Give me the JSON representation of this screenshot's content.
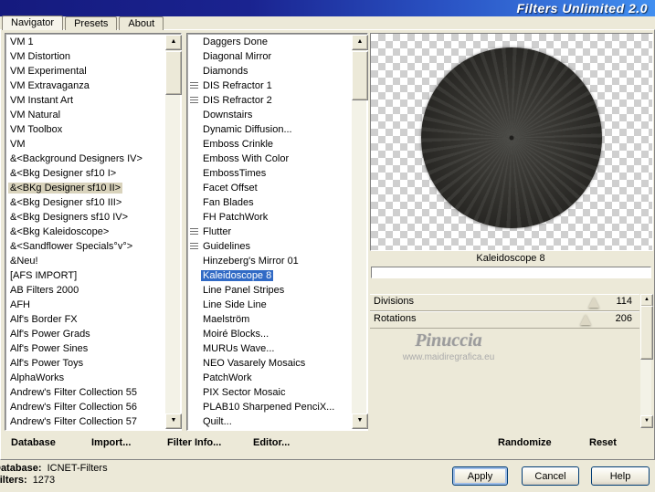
{
  "window": {
    "title": "Filters Unlimited 2.0"
  },
  "tabs": [
    {
      "label": "Navigator",
      "active": true
    },
    {
      "label": "Presets",
      "active": false
    },
    {
      "label": "About",
      "active": false
    }
  ],
  "categories": {
    "selected": "&<BKg Designer sf10 II>",
    "items": [
      {
        "label": "VM 1"
      },
      {
        "label": "VM Distortion"
      },
      {
        "label": "VM Experimental"
      },
      {
        "label": "VM Extravaganza"
      },
      {
        "label": "VM Instant Art"
      },
      {
        "label": "VM Natural"
      },
      {
        "label": "VM Toolbox"
      },
      {
        "label": "VM"
      },
      {
        "label": "&<Background Designers IV>"
      },
      {
        "label": "&<Bkg Designer sf10 I>"
      },
      {
        "label": "&<BKg Designer sf10 II>",
        "selected": true
      },
      {
        "label": "&<Bkg Designer sf10 III>"
      },
      {
        "label": "&<Bkg Designers sf10 IV>"
      },
      {
        "label": "&<Bkg Kaleidoscope>"
      },
      {
        "label": "&<Sandflower Specials°v°>"
      },
      {
        "label": "&Neu!"
      },
      {
        "label": "[AFS IMPORT]"
      },
      {
        "label": "AB Filters 2000"
      },
      {
        "label": "AFH"
      },
      {
        "label": "Alf's Border FX"
      },
      {
        "label": "Alf's Power Grads"
      },
      {
        "label": "Alf's Power Sines"
      },
      {
        "label": "Alf's Power Toys"
      },
      {
        "label": "AlphaWorks"
      },
      {
        "label": "Andrew's Filter Collection 55"
      },
      {
        "label": "Andrew's Filter Collection 56"
      },
      {
        "label": "Andrew's Filter Collection 57"
      }
    ]
  },
  "filters": {
    "selected": "Kaleidoscope 8",
    "items": [
      {
        "label": "Daggers Done"
      },
      {
        "label": "Diagonal Mirror"
      },
      {
        "label": "Diamonds"
      },
      {
        "label": "DIS Refractor 1",
        "icon": true
      },
      {
        "label": "DIS Refractor 2",
        "icon": true
      },
      {
        "label": "Downstairs"
      },
      {
        "label": "Dynamic Diffusion..."
      },
      {
        "label": "Emboss Crinkle"
      },
      {
        "label": "Emboss With Color"
      },
      {
        "label": "EmbossTimes"
      },
      {
        "label": "Facet Offset"
      },
      {
        "label": "Fan Blades"
      },
      {
        "label": "FH PatchWork"
      },
      {
        "label": "Flutter",
        "icon": true
      },
      {
        "label": "Guidelines",
        "icon": true
      },
      {
        "label": "Hinzeberg's Mirror 01"
      },
      {
        "label": "Kaleidoscope 8",
        "selected": true
      },
      {
        "label": "Line Panel Stripes"
      },
      {
        "label": "Line Side Line"
      },
      {
        "label": "Maelström"
      },
      {
        "label": "Moiré Blocks..."
      },
      {
        "label": "MURUs Wave..."
      },
      {
        "label": "NEO Vasarely Mosaics"
      },
      {
        "label": "PatchWork"
      },
      {
        "label": "PIX Sector Mosaic"
      },
      {
        "label": "PLAB10 Sharpened PenciX..."
      },
      {
        "label": "Quilt..."
      }
    ]
  },
  "preview": {
    "filter_name": "Kaleidoscope 8",
    "progress_percent": 0,
    "watermark_name": "Pinuccia",
    "watermark_site": "www.maidiregrafica.eu"
  },
  "parameters": [
    {
      "name": "Divisions",
      "value": "114",
      "thumb_pct": 83
    },
    {
      "name": "Rotations",
      "value": "206",
      "thumb_pct": 80
    }
  ],
  "toolbar": {
    "database": "Database",
    "import": "Import...",
    "filter_info": "Filter Info...",
    "editor": "Editor...",
    "randomize": "Randomize",
    "reset": "Reset"
  },
  "status": {
    "database_label": "Database:",
    "database_value": "ICNET-Filters",
    "filters_label": "Filters:",
    "filters_value": "1273"
  },
  "actions": {
    "apply": "Apply",
    "cancel": "Cancel",
    "help": "Help"
  },
  "colors": {
    "window_face": "#ECE9D8",
    "filter_selection": "#316AC5",
    "category_selection": "#D9D3BC",
    "titlebar_left": "#151A7E",
    "titlebar_right": "#418FF0"
  }
}
